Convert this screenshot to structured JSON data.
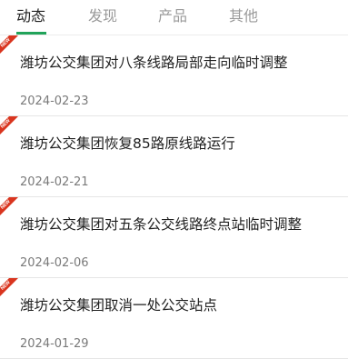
{
  "tabs": [
    {
      "label": "动态",
      "active": true
    },
    {
      "label": "发现",
      "active": false
    },
    {
      "label": "产品",
      "active": false
    },
    {
      "label": "其他",
      "active": false
    }
  ],
  "badge_label": "NEW",
  "colors": {
    "accent": "#21a35a",
    "badge": "#d9351f"
  },
  "news": [
    {
      "title": "潍坊公交集团对八条线路局部走向临时调整",
      "date": "2024-02-23",
      "badge": "NEW"
    },
    {
      "title": "潍坊公交集团恢复85路原线路运行",
      "date": "2024-02-21",
      "badge": "NEW"
    },
    {
      "title": "潍坊公交集团对五条公交线路终点站临时调整",
      "date": "2024-02-06",
      "badge": "NEW"
    },
    {
      "title": "潍坊公交集团取消一处公交站点",
      "date": "2024-01-29",
      "badge": "NEW"
    }
  ]
}
